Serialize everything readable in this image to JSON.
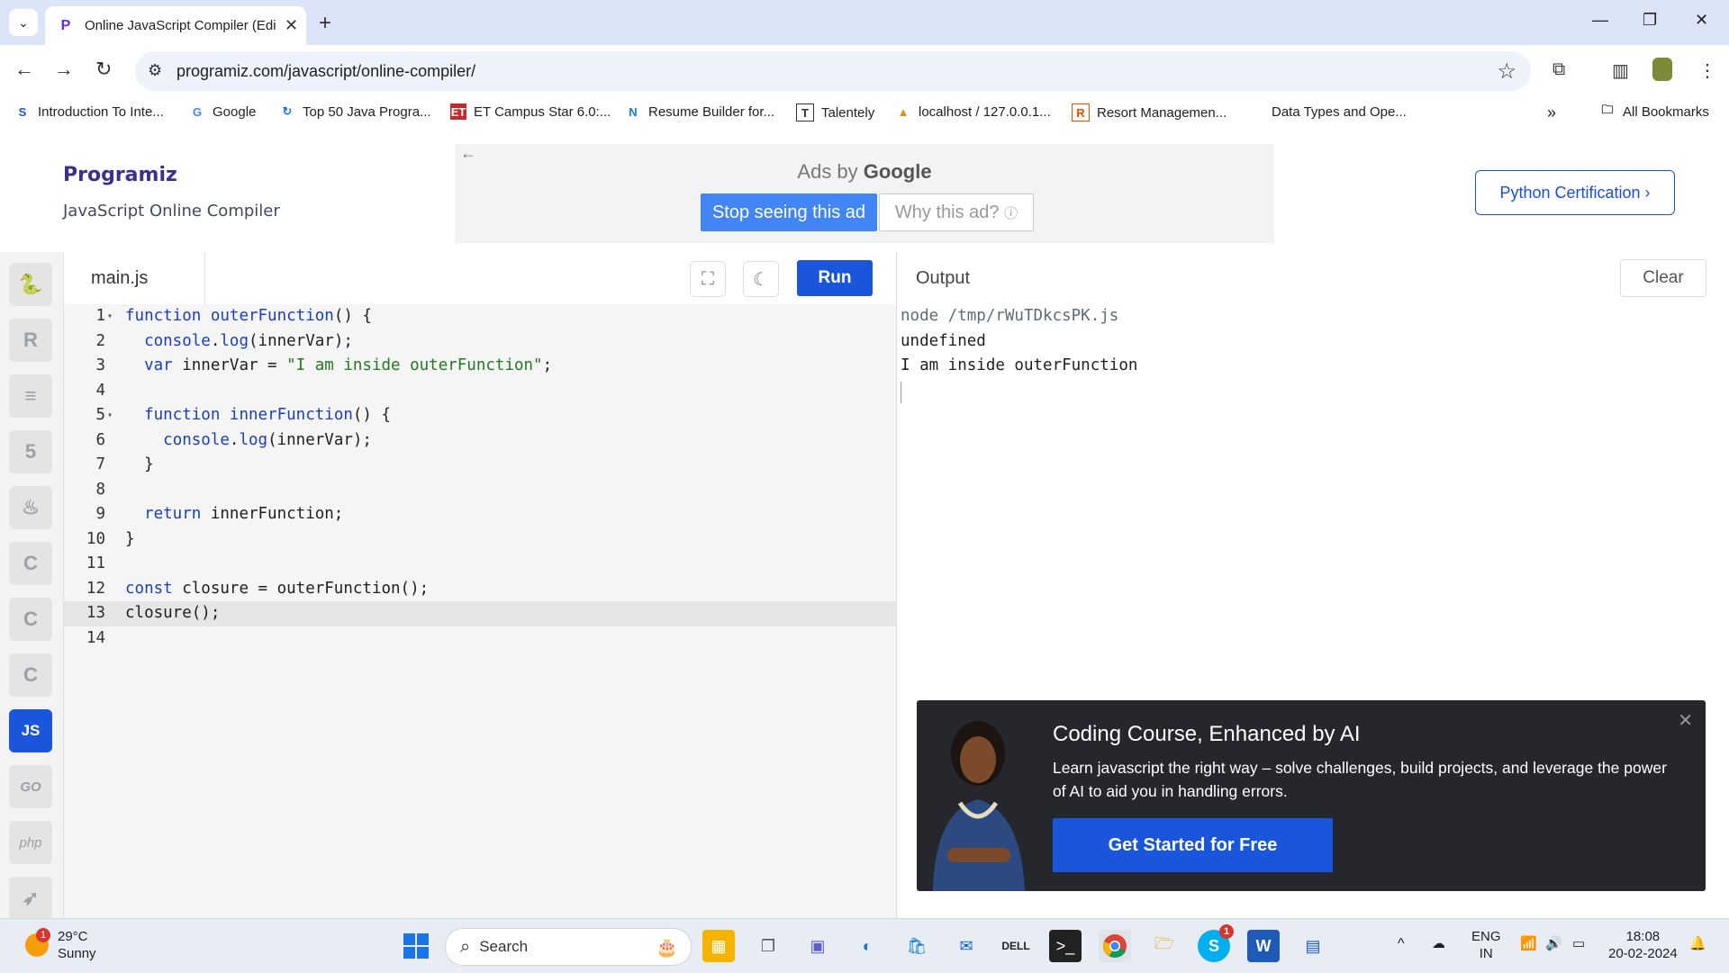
{
  "browser": {
    "tab_title": "Online JavaScript Compiler (Edi",
    "url": "programiz.com/javascript/online-compiler/",
    "bookmarks": [
      "Introduction To Inte...",
      "Google",
      "Top 50 Java Progra...",
      "ET Campus Star 6.0:...",
      "Resume Builder for...",
      "Talentely",
      "localhost / 127.0.0.1...",
      "Resort Managemen...",
      "Data Types and Ope..."
    ],
    "all_bookmarks": "All Bookmarks"
  },
  "header": {
    "logo": "Programiz",
    "subtitle": "JavaScript Online Compiler",
    "ad_label": "Ads by",
    "ad_brand": "Google",
    "stop_ad": "Stop seeing this ad",
    "why_ad": "Why this ad?",
    "cert_button": "Python Certification ›"
  },
  "sidebar": {
    "active_lang": "JS",
    "go_label": "GO",
    "php_label": "php"
  },
  "editor": {
    "filename": "main.js",
    "run_label": "Run",
    "line_numbers": [
      "1",
      "2",
      "3",
      "4",
      "5",
      "6",
      "7",
      "8",
      "9",
      "10",
      "11",
      "12",
      "13",
      "14"
    ],
    "active_line": 13
  },
  "output": {
    "title": "Output",
    "clear_label": "Clear",
    "lines": [
      "node /tmp/rWuTDkcsPK.js",
      "undefined",
      "I am inside outerFunction"
    ]
  },
  "promo": {
    "title": "Coding Course, Enhanced by AI",
    "text": "Learn javascript the right way – solve challenges, build projects, and leverage the power of AI to aid you in handling errors.",
    "button": "Get Started for Free"
  },
  "taskbar": {
    "temperature": "29°C",
    "condition": "Sunny",
    "weather_badge": "1",
    "search_placeholder": "Search",
    "skype_badge": "1",
    "lang": "ENG",
    "region": "IN",
    "time": "18:08",
    "date": "20-02-2024"
  },
  "colors": {
    "accent": "#1a56db",
    "ad_blue": "#4285f4",
    "promo_bg": "#25272c"
  }
}
